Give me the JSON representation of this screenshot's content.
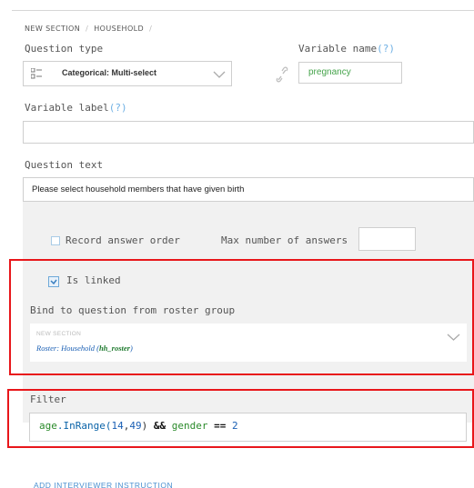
{
  "breadcrumb": {
    "section": "NEW SECTION",
    "subsection": "HOUSEHOLD"
  },
  "question_type": {
    "label": "Question type",
    "value": "Categorical: Multi-select",
    "icon": "multi-select-list-icon"
  },
  "variable_name": {
    "label": "Variable name",
    "help": "(?)",
    "value": "pregnancy"
  },
  "variable_label": {
    "label": "Variable label",
    "help": "(?)",
    "value": ""
  },
  "question_text": {
    "label": "Question text",
    "value": "Please select household members that have given birth"
  },
  "options": {
    "record_answer_order": {
      "label": "Record answer order",
      "checked": false
    },
    "max_answers": {
      "label": "Max number of answers",
      "value": ""
    },
    "is_linked": {
      "label": "Is linked",
      "checked": true
    }
  },
  "bind": {
    "label": "Bind to question from roster group",
    "section": "NEW SECTION",
    "roster_prefix": "Roster: Household (",
    "roster_var": "hh_roster",
    "roster_suffix": ")"
  },
  "filter": {
    "label": "Filter",
    "tokens": [
      {
        "text": "age",
        "kind": "var"
      },
      {
        "text": ".InRange(",
        "kind": "call"
      },
      {
        "text": "14",
        "kind": "num"
      },
      {
        "text": ",",
        "kind": "plain"
      },
      {
        "text": "49",
        "kind": "num"
      },
      {
        "text": ") ",
        "kind": "plain"
      },
      {
        "text": "&&",
        "kind": "kw"
      },
      {
        "text": " gender ",
        "kind": "var"
      },
      {
        "text": "==",
        "kind": "kw"
      },
      {
        "text": " 2",
        "kind": "num"
      }
    ]
  },
  "add_instruction": "ADD INTERVIEWER INSTRUCTION",
  "colors": {
    "highlight": "#e8161a",
    "link": "#4a90d0",
    "variable_green": "#44a34a"
  }
}
